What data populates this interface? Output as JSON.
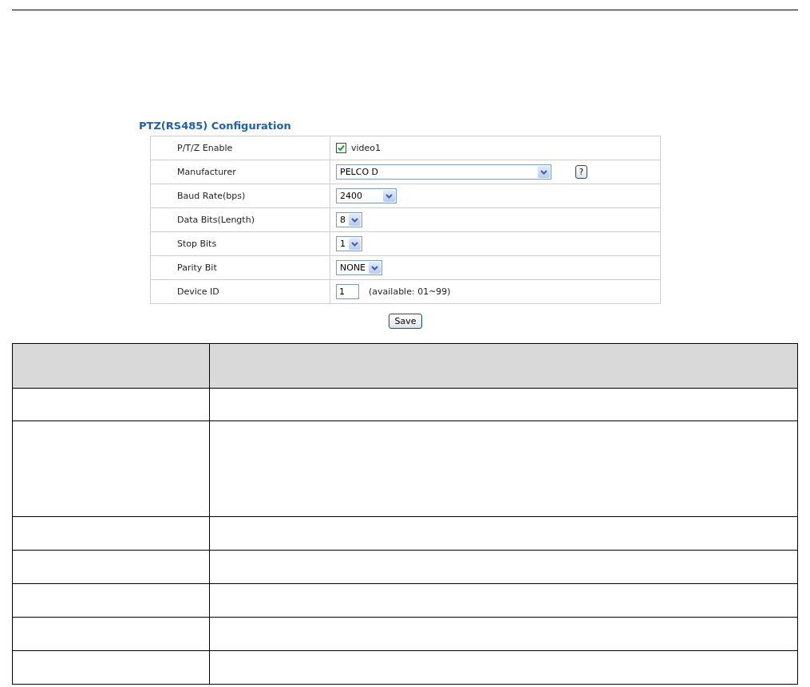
{
  "panel": {
    "title": "PTZ(RS485) Configuration",
    "rows": [
      {
        "label": "P/T/Z Enable",
        "kind": "checkbox",
        "checked": true,
        "value": "video1"
      },
      {
        "label": "Manufacturer",
        "kind": "select-help",
        "value": "PELCO D",
        "help": "?"
      },
      {
        "label": "Baud Rate(bps)",
        "kind": "select",
        "value": "2400"
      },
      {
        "label": "Data Bits(Length)",
        "kind": "select",
        "value": "8"
      },
      {
        "label": "Stop Bits",
        "kind": "select",
        "value": "1"
      },
      {
        "label": "Parity Bit",
        "kind": "select",
        "value": "NONE"
      },
      {
        "label": "Device ID",
        "kind": "number",
        "value": "1",
        "hint": "(available: 01~99)"
      }
    ],
    "save_button": "Save"
  }
}
